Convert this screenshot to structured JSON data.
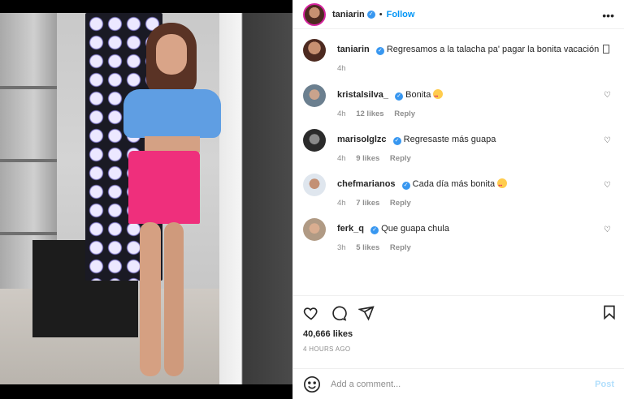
{
  "post": {
    "author": "taniarin",
    "follow_label": "Follow",
    "more_icon": "more-horizontal-icon",
    "caption": {
      "author": "taniarin",
      "text": "Regresamos a la talacha pa' pagar la bonita vacación",
      "time": "4h"
    },
    "comments": [
      {
        "user": "kristalsilva_",
        "text": "Bonita",
        "time": "4h",
        "likes": "12 likes",
        "reply": "Reply",
        "emoji": true
      },
      {
        "user": "marisolglzc",
        "text": "Regresaste más guapa",
        "time": "4h",
        "likes": "9 likes",
        "reply": "Reply",
        "emoji": false
      },
      {
        "user": "chefmarianos",
        "text": "Cada día más bonita",
        "time": "4h",
        "likes": "7 likes",
        "reply": "Reply",
        "emoji": true
      },
      {
        "user": "ferk_q",
        "text": "Que guapa chula",
        "time": "3h",
        "likes": "5 likes",
        "reply": "Reply",
        "emoji": false
      }
    ],
    "likes_count": "40,666 likes",
    "posted_ago": "4 HOURS AGO",
    "add_comment_placeholder": "Add a comment...",
    "post_label": "Post"
  },
  "colors": {
    "verified": "#3897f0",
    "follow": "#0095f6",
    "post_disabled": "#b2dffc",
    "muted": "#8e8e8e"
  }
}
